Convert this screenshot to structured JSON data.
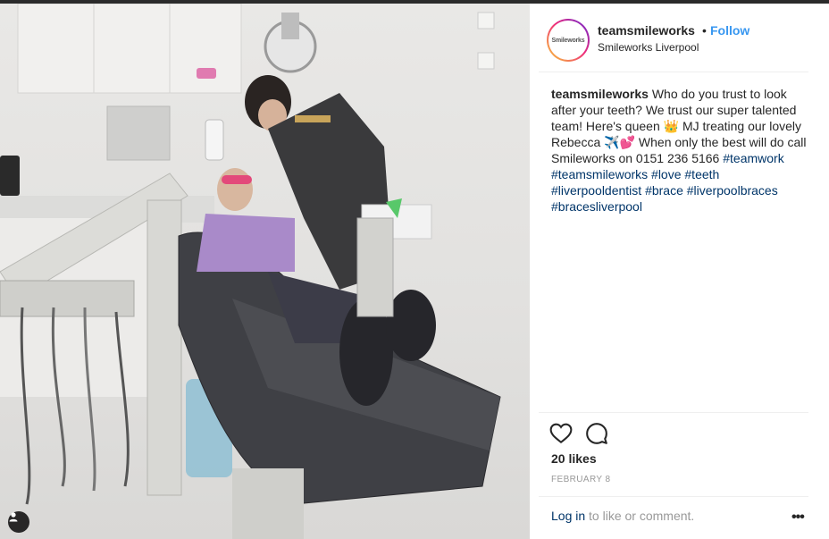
{
  "post": {
    "username": "teamsmileworks",
    "separator": "•",
    "follow_label": "Follow",
    "location": "Smileworks Liverpool",
    "avatar_logo_text": "Smileworks",
    "caption": {
      "user": "teamsmileworks",
      "text_part1": " Who do you trust to look after your teeth? We trust our super talented team! Here's queen ",
      "emoji_crown": "👑",
      "text_part2": " MJ treating our lovely Rebecca ",
      "emoji_plane_heart": "✈️💕",
      "text_part3": " When only the best will do call Smileworks on 0151 236 5166",
      "hashtags": [
        "#teamwork",
        "#teamsmileworks",
        "#love",
        "#teeth",
        "#liverpooldentist",
        "#brace",
        "#liverpoolbraces",
        "#bracesliverpool"
      ]
    },
    "likes_text": "20 likes",
    "date": "FEBRUARY 8",
    "login_link": "Log in",
    "login_suffix": " to like or comment.",
    "more_label": "•••"
  },
  "icons": {
    "like": "heart-icon",
    "comment": "comment-icon",
    "tag": "user-tag-icon"
  },
  "colors": {
    "follow": "#3897f0",
    "hashtag": "#003569",
    "muted": "#999999"
  }
}
